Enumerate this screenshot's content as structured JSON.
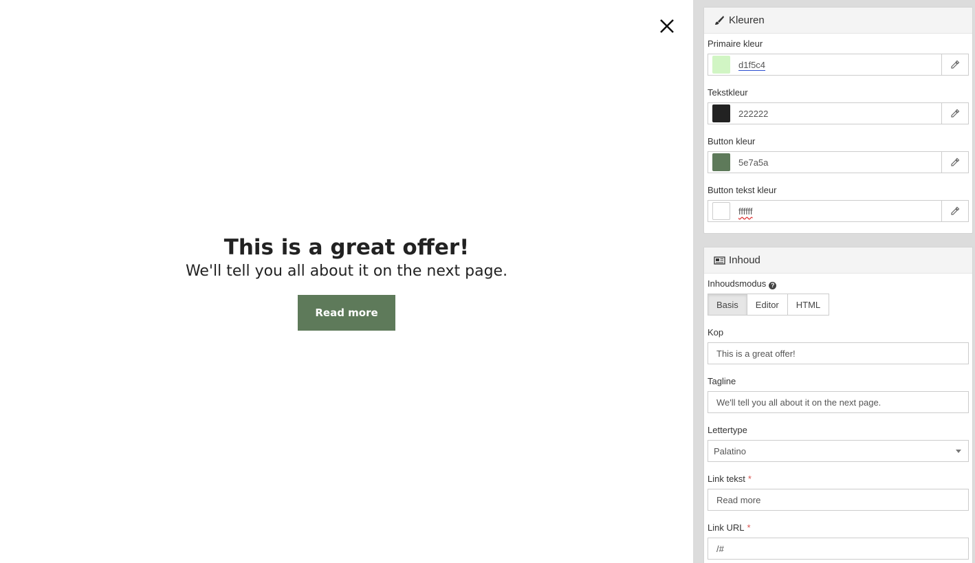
{
  "preview": {
    "title": "This is a great offer!",
    "tagline": "We'll tell you all about it on the next page.",
    "button_label": "Read more",
    "button_color": "#5e7a5a",
    "button_text_color": "#ffffff",
    "text_color": "#222222",
    "close_icon": "close-icon"
  },
  "colors_panel": {
    "title": "Kleuren",
    "icon": "paintbrush-icon",
    "fields": [
      {
        "label": "Primaire kleur",
        "value": "d1f5c4",
        "swatch": "#d1f5c4"
      },
      {
        "label": "Tekstkleur",
        "value": "222222",
        "swatch": "#222222"
      },
      {
        "label": "Button kleur",
        "value": "5e7a5a",
        "swatch": "#5e7a5a"
      },
      {
        "label": "Button tekst kleur",
        "value": "ffffff",
        "swatch": "#ffffff"
      }
    ],
    "picker_icon": "eyedropper-icon"
  },
  "content_panel": {
    "title": "Inhoud",
    "icon": "newspaper-icon",
    "mode_label": "Inhoudsmodus",
    "modes": [
      "Basis",
      "Editor",
      "HTML"
    ],
    "active_mode": "Basis",
    "kop_label": "Kop",
    "kop_value": "This is a great offer!",
    "tagline_label": "Tagline",
    "tagline_value": "We'll tell you all about it on the next page.",
    "font_label": "Lettertype",
    "font_value": "Palatino",
    "link_text_label": "Link tekst",
    "link_text_value": "Read more",
    "link_url_label": "Link URL",
    "link_url_value": "/#",
    "required_mark": "*"
  }
}
